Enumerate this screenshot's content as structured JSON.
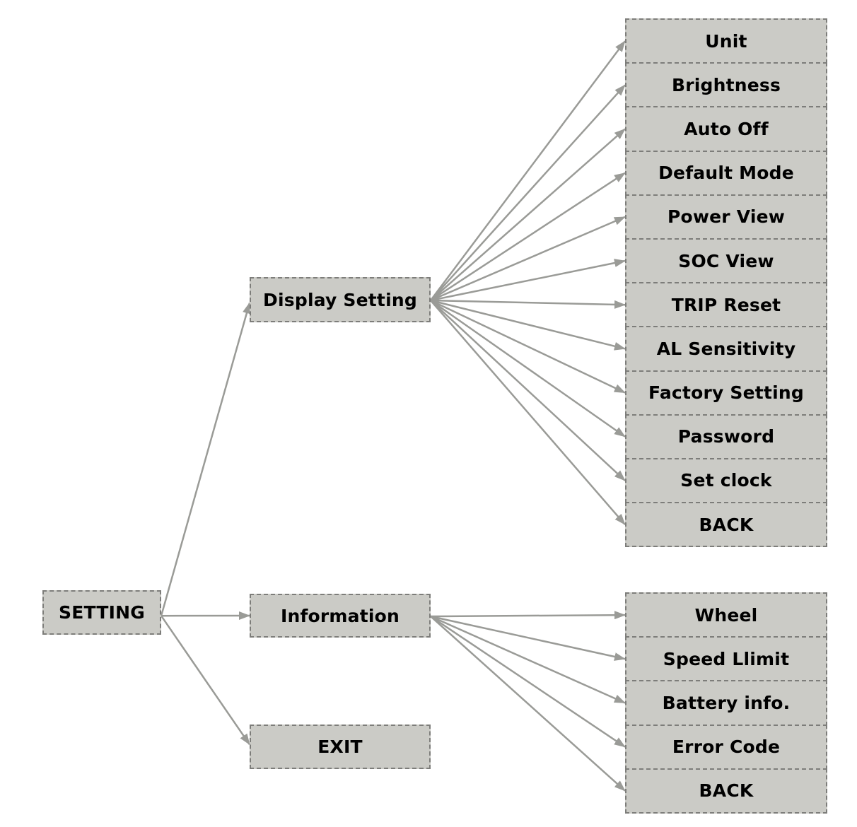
{
  "diagram": {
    "root": {
      "label": "SETTING"
    },
    "level1": [
      {
        "id": "display",
        "label": "Display Setting"
      },
      {
        "id": "information",
        "label": "Information"
      },
      {
        "id": "exit",
        "label": "EXIT"
      }
    ],
    "display_items": [
      "Unit",
      "Brightness",
      "Auto Off",
      "Default Mode",
      "Power View",
      "SOC View",
      "TRIP Reset",
      "AL Sensitivity",
      "Factory Setting",
      "Password",
      "Set clock",
      "BACK"
    ],
    "information_items": [
      "Wheel",
      "Speed Llimit",
      "Battery info.",
      "Error Code",
      "BACK"
    ],
    "edges": [
      {
        "from": "SETTING",
        "to": "Display Setting"
      },
      {
        "from": "SETTING",
        "to": "Information"
      },
      {
        "from": "SETTING",
        "to": "EXIT"
      },
      {
        "from": "Display Setting",
        "to": "all display_items"
      },
      {
        "from": "Information",
        "to": "all information_items"
      }
    ],
    "colors": {
      "box_fill": "#cbcbc6",
      "box_border": "#7d7d7a",
      "arrow": "#9a9b97",
      "text": "#000000"
    }
  }
}
